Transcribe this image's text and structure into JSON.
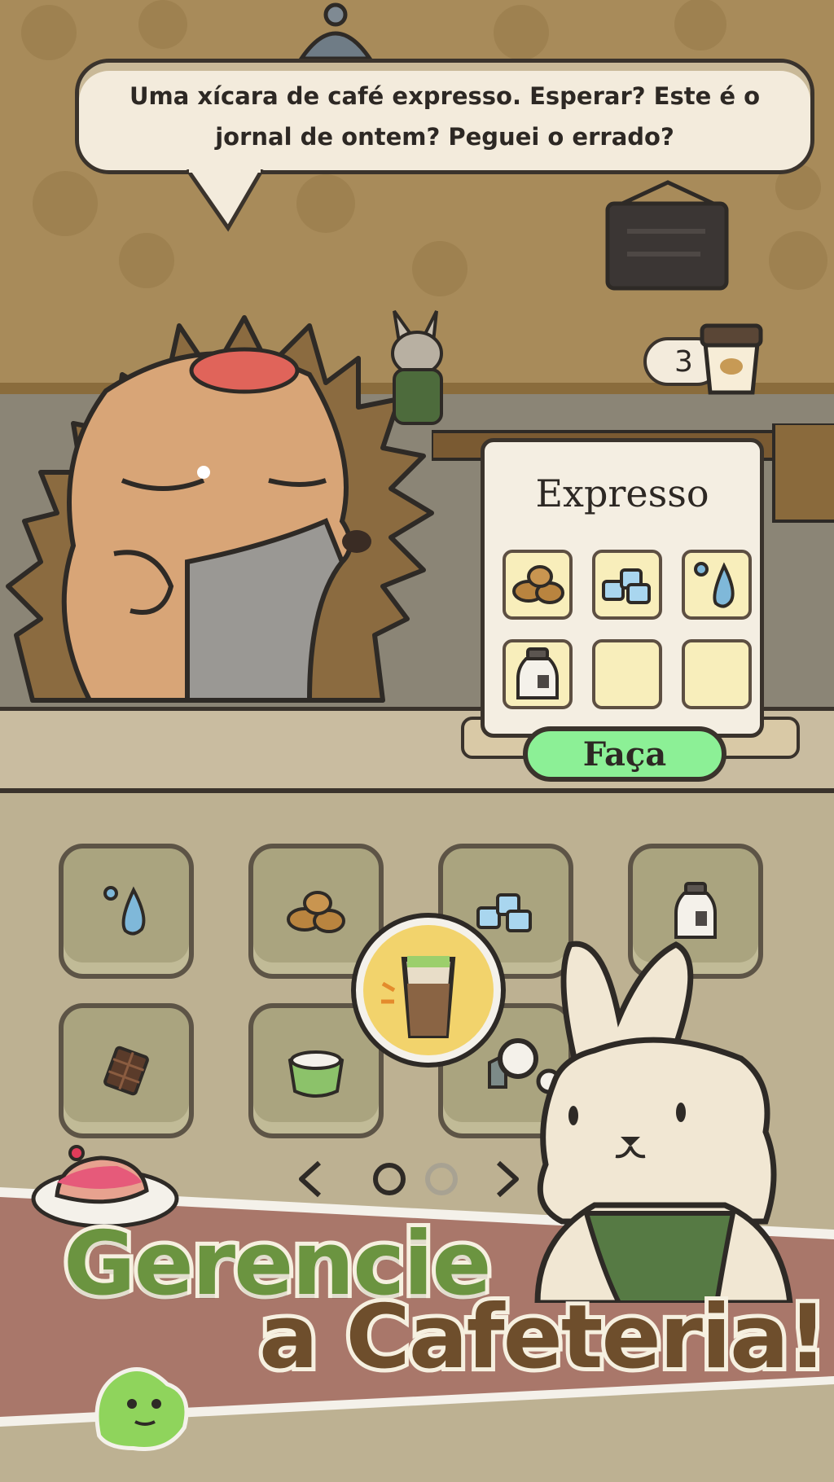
{
  "dialogue": {
    "text": "Uma xícara de café expresso. Esperar? Este é o jornal de ontem? Peguei o errado?"
  },
  "cup_counter": {
    "count": "3",
    "icon": "coffee-cup-icon"
  },
  "recipe": {
    "title": "Expresso",
    "slots": [
      "coffee-beans-icon",
      "ice-cubes-icon",
      "water-drop-icon",
      "milk-jar-icon",
      "",
      ""
    ],
    "make_label": "Faça",
    "button_color": "#8cf096"
  },
  "ingredients": [
    "water-drop-icon",
    "coffee-beans-icon",
    "ice-cubes-icon",
    "milk-jar-icon",
    "chocolate-icon",
    "matcha-icon",
    "ingredient-icon"
  ],
  "thought": {
    "icon": "iced-coffee-icon"
  },
  "pager": {
    "current_page": 1,
    "total_pages": 2
  },
  "banner": {
    "line1": "Gerencie",
    "line2": "a Cafeteria!",
    "line1_color": "#6b9440",
    "line2_color": "#6e4e2c",
    "band_color": "#a9776a"
  }
}
